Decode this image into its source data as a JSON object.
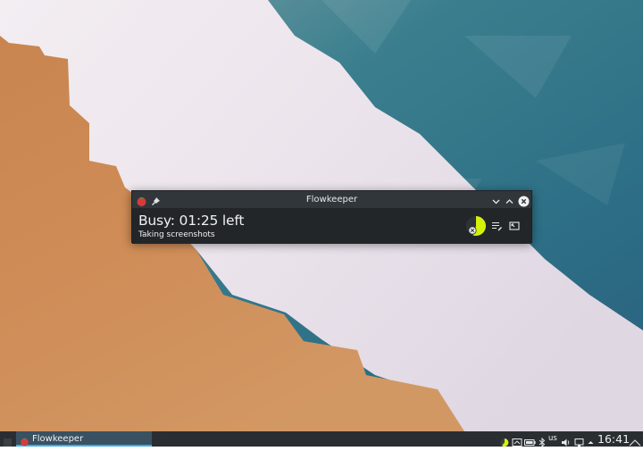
{
  "window": {
    "title": "Flowkeeper",
    "status": "Busy: 01:25 left",
    "task": "Taking screenshots",
    "timer_remaining_fraction": 0.55,
    "colors": {
      "accent": "#d7f20a",
      "body": "#232629",
      "titlebar": "#31363b"
    }
  },
  "taskbar": {
    "task_label": "Flowkeeper",
    "keyboard_layout": "us",
    "clock": "16:41",
    "colors": {
      "panel": "#2a2e32",
      "active_task": "#3a5161",
      "indicator": "#3daee9"
    }
  },
  "icons": [
    "flowkeeper-app-icon",
    "pin-icon",
    "minimize-icon",
    "maximize-icon",
    "close-icon",
    "void-icon",
    "task-list-icon",
    "restore-window-icon",
    "timer-tray-icon",
    "clipboard-icon",
    "battery-icon",
    "bluetooth-icon",
    "volume-icon",
    "display-icon",
    "expand-tray-icon",
    "panel-menu-icon"
  ]
}
